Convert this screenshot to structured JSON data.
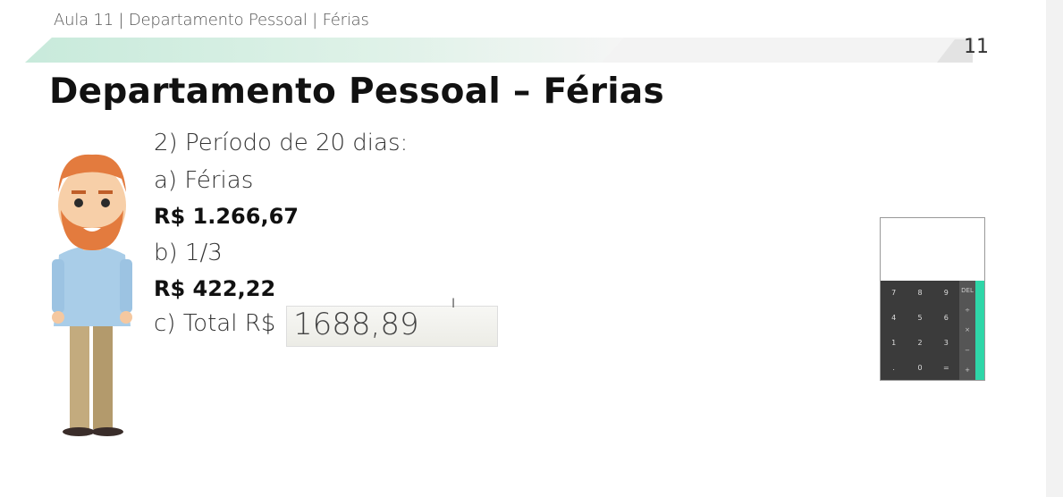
{
  "header": {
    "breadcrumb": "Aula 11 | Departamento Pessoal | Férias",
    "page_number": "11"
  },
  "title": "Departamento Pessoal – Férias",
  "content": {
    "line1": "2) Período de 20 dias:",
    "line2": "a) Férias",
    "line3": "R$ 1.266,67",
    "line4": "b) 1/3",
    "line5": "R$ 422,22",
    "line6_label": "c) Total R$",
    "line6_value": "1688,89"
  },
  "calculator": {
    "keys": [
      "7",
      "8",
      "9",
      "4",
      "5",
      "6",
      "1",
      "2",
      "3",
      ".",
      "0",
      "="
    ],
    "ops": [
      "DEL",
      "÷",
      "×",
      "−",
      "+"
    ]
  },
  "colors": {
    "band": "#d4eedf",
    "accent": "#2ed6a8",
    "page_tab": "#e3e3e3"
  }
}
